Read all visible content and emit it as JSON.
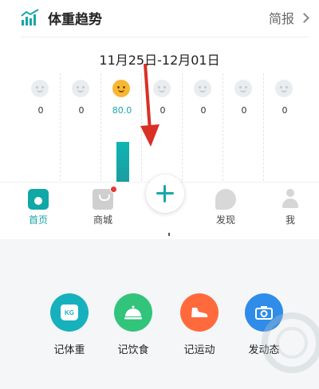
{
  "header": {
    "title": "体重趋势",
    "brief_label": "简报",
    "accent": "#17a7a8"
  },
  "date_range": "11月25日-12月01日",
  "days": [
    {
      "value": "0",
      "active": false
    },
    {
      "value": "0",
      "active": false
    },
    {
      "value": "80.0",
      "active": true
    },
    {
      "value": "0",
      "active": false
    },
    {
      "value": "0",
      "active": false
    },
    {
      "value": "0",
      "active": false
    },
    {
      "value": "0",
      "active": false
    }
  ],
  "nav": {
    "items": [
      {
        "label": "首页",
        "icon": "home-icon",
        "active": true
      },
      {
        "label": "商城",
        "icon": "shop-icon",
        "active": false,
        "badge": true
      },
      {
        "label": "发现",
        "icon": "discover-icon",
        "active": false
      },
      {
        "label": "我",
        "icon": "profile-icon",
        "active": false
      }
    ],
    "fab_icon": "plus-icon"
  },
  "actions": [
    {
      "label": "记体重",
      "icon": "scale-icon",
      "icon_text": "KG",
      "color": "#16b1bd"
    },
    {
      "label": "记饮食",
      "icon": "food-icon",
      "color": "#32c47a"
    },
    {
      "label": "记运动",
      "icon": "shoe-icon",
      "color": "#ff6a3d"
    },
    {
      "label": "发动态",
      "icon": "camera-icon",
      "color": "#2f8ce8"
    }
  ],
  "annotation": {
    "arrow_color": "#d93025"
  }
}
